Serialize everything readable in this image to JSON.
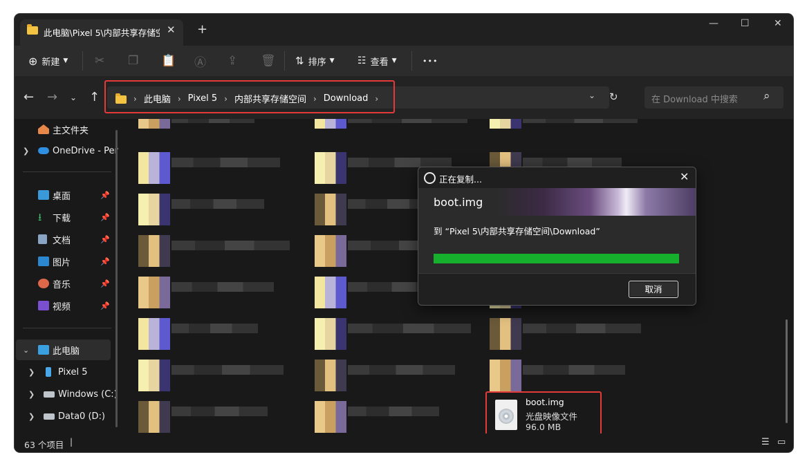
{
  "window": {
    "tab_title": "此电脑\\Pixel 5\\内部共享存储空",
    "tab_close": "✕",
    "new_tab": "+"
  },
  "toolbar": {
    "new_label": "新建",
    "sort_label": "排序",
    "view_label": "查看",
    "more_label": "•••"
  },
  "address": {
    "crumbs": [
      "此电脑",
      "Pixel 5",
      "内部共享存储空间",
      "Download"
    ],
    "search_placeholder": "在 Download 中搜索"
  },
  "sidebar": {
    "items": [
      {
        "label": "主文件夹",
        "icon": "home-icon"
      },
      {
        "label": "OneDrive - Per",
        "icon": "cloud-icon"
      },
      {
        "label": "桌面",
        "icon": "desktop-icon",
        "pinned": true
      },
      {
        "label": "下载",
        "icon": "download-icon",
        "pinned": true
      },
      {
        "label": "文档",
        "icon": "document-icon",
        "pinned": true
      },
      {
        "label": "图片",
        "icon": "picture-icon",
        "pinned": true
      },
      {
        "label": "音乐",
        "icon": "music-icon",
        "pinned": true
      },
      {
        "label": "视频",
        "icon": "video-icon",
        "pinned": true
      },
      {
        "label": "此电脑",
        "icon": "computer-icon"
      },
      {
        "label": "Pixel 5",
        "icon": "phone-icon"
      },
      {
        "label": "Windows (C:)",
        "icon": "drive-icon"
      },
      {
        "label": "Data0 (D:)",
        "icon": "drive-icon"
      }
    ]
  },
  "file": {
    "name": "boot.img",
    "type": "光盘映像文件",
    "size": "96.0 MB"
  },
  "status": {
    "count_text": "63 个项目"
  },
  "dialog": {
    "title": "正在复制...",
    "filename": "boot.img",
    "destination": "到 “Pixel 5\\内部共享存储空间\\Download”",
    "progress": 1.0,
    "cancel_label": "取消",
    "close": "✕"
  },
  "colors": {
    "highlight": "#e43a3a",
    "progress": "#16b02c",
    "folder": "#f5c342"
  }
}
